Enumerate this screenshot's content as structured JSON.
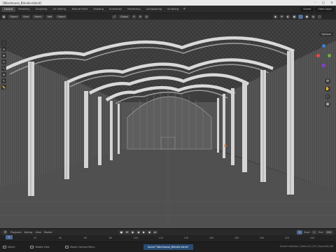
{
  "window": {
    "title": "[Warehouse_Blender.blend]",
    "minimize": "–",
    "maximize": "□",
    "close": "×"
  },
  "workspaces": [
    "Layout",
    "Modeling",
    "Sculpting",
    "UV Editing",
    "Texture Paint",
    "Shading",
    "Animation",
    "Rendering",
    "Compositing",
    "Scripting"
  ],
  "active_workspace": "Layout",
  "scene": {
    "name": "Scene",
    "view_layer": "View Layer"
  },
  "viewport_header": {
    "mode": "Object",
    "view": "View",
    "select": "Select",
    "add": "Add",
    "object": "Object",
    "transform": "Global",
    "options": "Options"
  },
  "timeline": {
    "menus": [
      "Playback",
      "Keying",
      "View",
      "Marker"
    ],
    "start_label": "Start",
    "start": "1",
    "end_label": "End",
    "end": "250",
    "current_frame": "1",
    "ruler_ticks": [
      "0",
      "20",
      "40",
      "60",
      "80",
      "100",
      "120",
      "140",
      "160",
      "180",
      "200",
      "220",
      "240"
    ]
  },
  "statusbar": {
    "items": [
      "Select",
      "Rotate View",
      "Object Context Menu"
    ],
    "taskbar": "Saved \"Warehouse_Blender.blend\"",
    "stats": "Scene Collection | Verts:122,103 | Faces:84,336"
  },
  "icons": {
    "gizmo_x": "#e24a4a",
    "gizmo_y": "#6ab33a",
    "gizmo_z": "#3b7ed8"
  }
}
